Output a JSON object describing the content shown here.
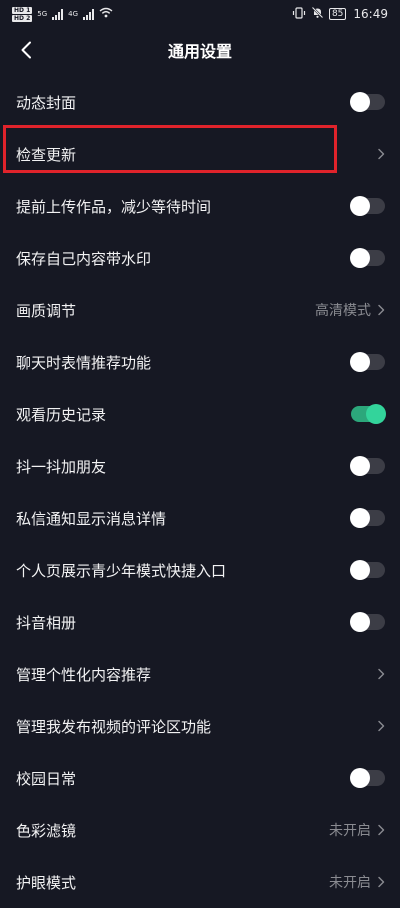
{
  "status_bar": {
    "sim1": "HD 1",
    "sim2": "HD 2",
    "net1": "5G",
    "net2": "4G",
    "battery": "85",
    "time": "16:49"
  },
  "header": {
    "title": "通用设置"
  },
  "settings": [
    {
      "label": "动态封面",
      "type": "toggle",
      "on": false
    },
    {
      "label": "检查更新",
      "type": "link",
      "value": ""
    },
    {
      "label": "提前上传作品，减少等待时间",
      "type": "toggle",
      "on": false
    },
    {
      "label": "保存自己内容带水印",
      "type": "toggle",
      "on": false
    },
    {
      "label": "画质调节",
      "type": "link",
      "value": "高清模式"
    },
    {
      "label": "聊天时表情推荐功能",
      "type": "toggle",
      "on": false
    },
    {
      "label": "观看历史记录",
      "type": "toggle",
      "on": true
    },
    {
      "label": "抖一抖加朋友",
      "type": "toggle",
      "on": false
    },
    {
      "label": "私信通知显示消息详情",
      "type": "toggle",
      "on": false
    },
    {
      "label": "个人页展示青少年模式快捷入口",
      "type": "toggle",
      "on": false
    },
    {
      "label": "抖音相册",
      "type": "toggle",
      "on": false
    },
    {
      "label": "管理个性化内容推荐",
      "type": "link",
      "value": ""
    },
    {
      "label": "管理我发布视频的评论区功能",
      "type": "link",
      "value": ""
    },
    {
      "label": "校园日常",
      "type": "toggle",
      "on": false
    },
    {
      "label": "色彩滤镜",
      "type": "link",
      "value": "未开启"
    },
    {
      "label": "护眼模式",
      "type": "link",
      "value": "未开启"
    }
  ],
  "colors": {
    "background": "#161823",
    "toggle_on": "#33d49b",
    "highlight": "#e0232b"
  }
}
